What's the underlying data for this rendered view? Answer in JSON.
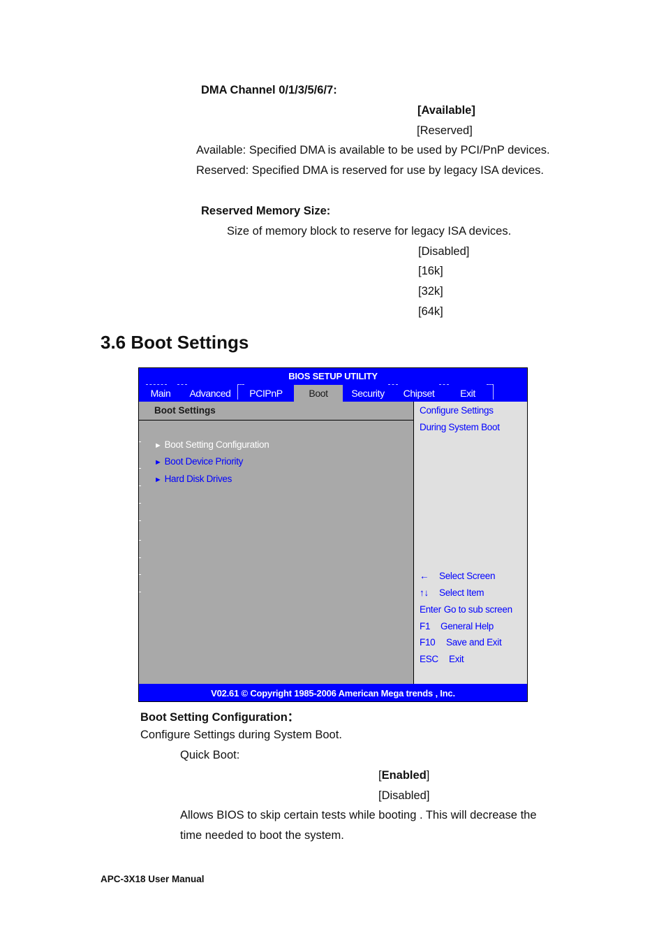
{
  "dma_section": {
    "heading": "DMA Channel 0/1/3/5/6/7:",
    "options": [
      "[Available]",
      "[Reserved]"
    ],
    "default_option": "[Available]",
    "descriptions": [
      "Available: Specified DMA is available to be used by PCI/PnP devices.",
      "Reserved: Specified DMA is reserved for use by legacy ISA devices."
    ]
  },
  "reserved_memory_section": {
    "heading": "Reserved Memory Size:",
    "description": "Size of memory block to reserve for legacy ISA devices.",
    "options": [
      "[Disabled]",
      "[16k]",
      "[32k]",
      "[64k]"
    ]
  },
  "section_title": "3.6 Boot Settings",
  "bios": {
    "title": "BIOS SETUP UTILITY",
    "tabs": [
      "Main",
      "Advanced",
      "PCIPnP",
      "Boot",
      "Security",
      "Chipset",
      "Exit"
    ],
    "active_tab": "Boot",
    "panel_title": "Boot Settings",
    "menu_items": [
      {
        "label": "Boot Setting Configuration",
        "selected": true
      },
      {
        "label": "Boot Device Priority",
        "selected": false
      },
      {
        "label": "Hard Disk Drives",
        "selected": false
      }
    ],
    "help_text": [
      "Configure Settings",
      "During System Boot"
    ],
    "keys": [
      {
        "key": "←",
        "action": "Select Screen"
      },
      {
        "key": "↑↓",
        "action": "Select Item"
      },
      {
        "key": "Enter",
        "action": "Go to sub screen"
      },
      {
        "key": "F1",
        "action": "General Help"
      },
      {
        "key": "F10",
        "action": "Save and Exit"
      },
      {
        "key": "ESC",
        "action": "Exit"
      }
    ],
    "footer": "V02.61 © Copyright 1985-2006 American Mega trends , Inc.",
    "colors": {
      "frame_blue": "#0000ff",
      "left_panel_gray": "#a9a9a9",
      "right_panel_gray": "#e0e0e0"
    }
  },
  "boot_config_section": {
    "heading": "Boot Setting Configuration：",
    "description": "Configure Settings during System Boot.",
    "quick_boot_label": "Quick Boot:",
    "options": [
      {
        "bracket_open": "[",
        "label": "Enabled",
        "bracket_close": "]",
        "default": true
      },
      {
        "bracket_open": "[",
        "label": "Disabled",
        "bracket_close": "]",
        "default": false
      }
    ],
    "explanation_lines": [
      "Allows BIOS to skip certain tests while booting . This will decrease the",
      "time needed to boot the system."
    ]
  },
  "page_footer": "APC-3X18 User Manual"
}
